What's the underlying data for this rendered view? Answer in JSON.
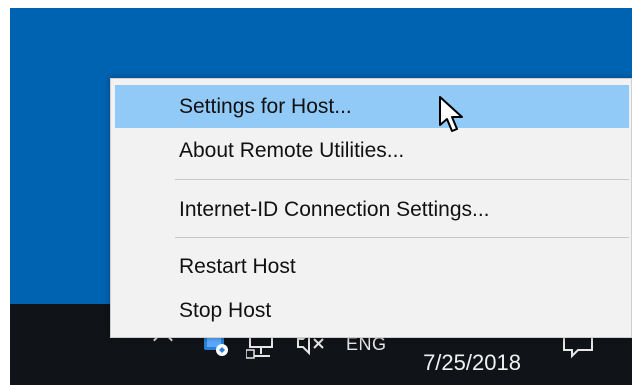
{
  "context_menu": {
    "items": [
      {
        "label": "Settings for Host...",
        "highlighted": true
      },
      {
        "label": "About Remote Utilities..."
      },
      {
        "label": "Internet-ID Connection Settings..."
      },
      {
        "label": "Restart Host"
      },
      {
        "label": "Stop Host"
      }
    ]
  },
  "taskbar": {
    "language": "ENG",
    "date": "7/25/2018",
    "icons": [
      "chevron-up-icon",
      "remote-host-icon",
      "network-icon",
      "volume-muted-icon",
      "notification-icon"
    ]
  },
  "colors": {
    "desktop": "#0063b1",
    "taskbar": "#101418",
    "menu_bg": "#f2f2f2",
    "highlight": "#91c9f7"
  }
}
